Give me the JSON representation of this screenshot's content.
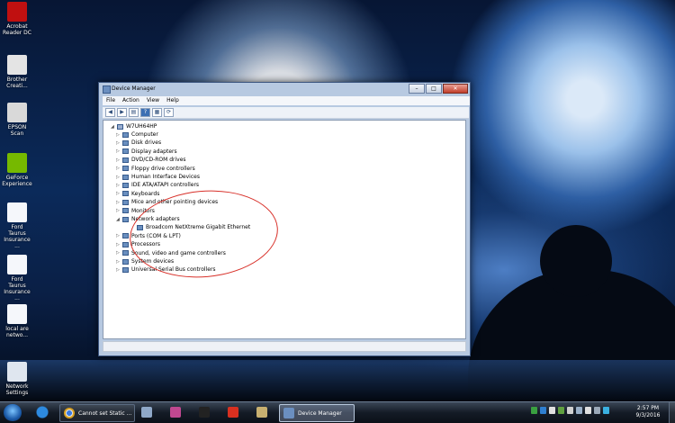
{
  "desktop": {
    "icons": [
      {
        "label": "Acrobat Reader DC",
        "icon": "acrobat-icon",
        "color": "#c01010"
      },
      {
        "label": "Brother Creati...",
        "icon": "brother-creative-icon",
        "color": "#e4e4e4"
      },
      {
        "label": "EPSON Scan",
        "icon": "scanner-icon",
        "color": "#d9d9d9"
      },
      {
        "label": "GeForce Experience",
        "icon": "geforce-icon",
        "color": "#76b900"
      },
      {
        "label": "Ford Taurus Insurance ...",
        "icon": "document-icon",
        "color": "#f5f7fb"
      },
      {
        "label": "Ford Taurus Insurance ...",
        "icon": "document-icon",
        "color": "#f5f7fb"
      },
      {
        "label": "local are netwo...",
        "icon": "text-file-icon",
        "color": "#f5f7fb"
      },
      {
        "label": "Network Settings",
        "icon": "network-settings-icon",
        "color": "#dfe6ef"
      }
    ]
  },
  "window": {
    "title": "Device Manager",
    "controls": {
      "minimize": "–",
      "maximize": "□",
      "close": "✕"
    },
    "menu": [
      "File",
      "Action",
      "View",
      "Help"
    ],
    "toolbar": [
      {
        "icon": "back-arrow-icon",
        "glyph": "◀"
      },
      {
        "icon": "forward-arrow-icon",
        "glyph": "▶"
      },
      {
        "icon": "device-tree-view-icon",
        "glyph": "▤"
      },
      {
        "icon": "help-icon",
        "glyph": "?"
      },
      {
        "icon": "properties-icon",
        "glyph": "▦"
      },
      {
        "icon": "scan-hardware-icon",
        "glyph": "⟳"
      }
    ],
    "tree": {
      "root": "W7UH64HP",
      "items": [
        {
          "label": "Computer",
          "expander": "▷",
          "icon": "computer-icon"
        },
        {
          "label": "Disk drives",
          "expander": "▷",
          "icon": "disk-drive-icon"
        },
        {
          "label": "Display adapters",
          "expander": "▷",
          "icon": "display-adapter-icon"
        },
        {
          "label": "DVD/CD-ROM drives",
          "expander": "▷",
          "icon": "dvd-drive-icon"
        },
        {
          "label": "Floppy drive controllers",
          "expander": "▷",
          "icon": "floppy-controller-icon"
        },
        {
          "label": "Human Interface Devices",
          "expander": "▷",
          "icon": "hid-icon"
        },
        {
          "label": "IDE ATA/ATAPI controllers",
          "expander": "▷",
          "icon": "ide-controller-icon"
        },
        {
          "label": "Keyboards",
          "expander": "▷",
          "icon": "keyboard-icon"
        },
        {
          "label": "Mice and other pointing devices",
          "expander": "▷",
          "icon": "mouse-icon"
        },
        {
          "label": "Monitors",
          "expander": "▷",
          "icon": "monitor-icon"
        },
        {
          "label": "Network adapters",
          "expander": "◢",
          "icon": "network-adapter-icon"
        },
        {
          "label": "Broadcom NetXtreme Gigabit Ethernet",
          "expander": "",
          "icon": "ethernet-adapter-icon",
          "child": true
        },
        {
          "label": "Ports (COM & LPT)",
          "expander": "▷",
          "icon": "port-icon"
        },
        {
          "label": "Processors",
          "expander": "▷",
          "icon": "processor-icon"
        },
        {
          "label": "Sound, video and game controllers",
          "expander": "▷",
          "icon": "sound-icon"
        },
        {
          "label": "System devices",
          "expander": "▷",
          "icon": "system-device-icon"
        },
        {
          "label": "Universal Serial Bus controllers",
          "expander": "▷",
          "icon": "usb-icon"
        }
      ]
    }
  },
  "taskbar": {
    "pinned": [
      {
        "icon": "internet-explorer-icon",
        "color": "#2d8ae0"
      },
      {
        "icon": "chrome-icon",
        "color": "#d8a020"
      }
    ],
    "chrome_task": {
      "label": "Cannot set Static ...",
      "icon": "chrome-icon"
    },
    "apps": [
      {
        "icon": "launcher-icon",
        "color": "#8fa8c8"
      },
      {
        "icon": "paint-icon",
        "color": "#c04890"
      },
      {
        "icon": "command-prompt-icon",
        "color": "#222222"
      },
      {
        "icon": "security-app-icon",
        "color": "#d83020"
      },
      {
        "icon": "scanner-task-icon",
        "color": "#c8b070"
      }
    ],
    "active_task": {
      "label": "Device Manager",
      "icon": "device-manager-icon"
    },
    "tray_colors": [
      "#3aa040",
      "#2f7fd0",
      "#e0e0e0",
      "#60a040",
      "#d0d0d0",
      "#9ab0c8",
      "#e0e0e0",
      "#9aa8b8",
      "#3ab0e0"
    ],
    "clock": {
      "time": "2:57 PM",
      "date": "9/3/2016"
    }
  }
}
